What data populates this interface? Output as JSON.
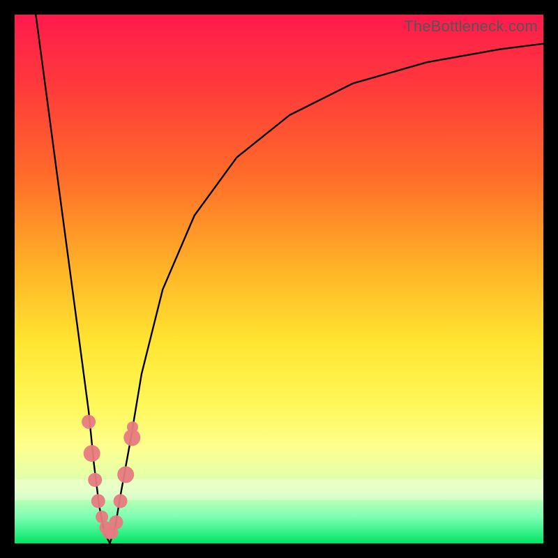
{
  "watermark": "TheBottleneck.com",
  "colors": {
    "frame": "#000000",
    "gradient_top": "#ff1a4d",
    "gradient_bottom": "#00e565",
    "curve": "#000000",
    "markers": "#e77a7f"
  },
  "chart_data": {
    "type": "line",
    "title": "",
    "xlabel": "",
    "ylabel": "",
    "xlim": [
      0,
      100
    ],
    "ylim": [
      0,
      100
    ],
    "series": [
      {
        "name": "bottleneck-curve",
        "x": [
          4,
          6,
          8,
          10,
          12,
          14,
          15,
          16,
          17,
          18,
          19,
          20,
          22,
          24,
          28,
          34,
          42,
          52,
          64,
          78,
          92,
          100
        ],
        "y": [
          100,
          85,
          70,
          55,
          40,
          25,
          15,
          7,
          2,
          0,
          3,
          9,
          20,
          32,
          48,
          62,
          73,
          81,
          87,
          91,
          93.5,
          94.5
        ]
      }
    ],
    "markers": {
      "name": "highlight-points",
      "x": [
        14.0,
        14.6,
        15.2,
        15.8,
        16.5,
        17.2,
        17.8,
        18.4,
        19.2,
        20.0,
        21.0,
        22.2,
        22.3
      ],
      "y": [
        23,
        17,
        12,
        8,
        5,
        3,
        2,
        2,
        4,
        8,
        13,
        20,
        22
      ],
      "size": [
        10,
        12,
        10,
        10,
        9,
        9,
        9,
        9,
        10,
        10,
        12,
        12,
        8
      ]
    }
  }
}
